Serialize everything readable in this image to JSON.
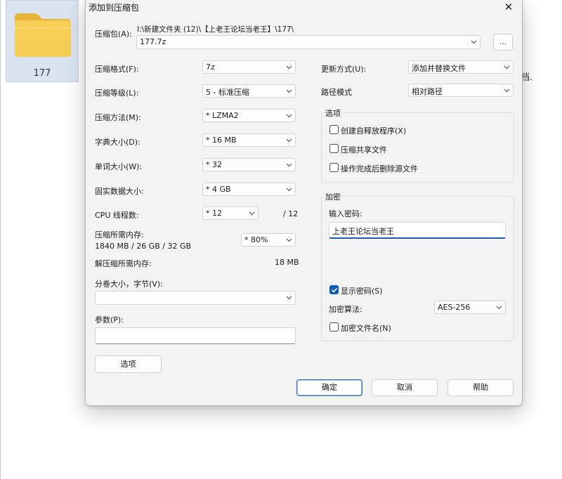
{
  "desktop": {
    "folder_name": "177",
    "right_fragment": "档."
  },
  "dialog": {
    "title": "添加到压缩包",
    "archive_label": "压缩包(A):",
    "archive_path": "I:\\新建文件夹 (12)\\【上老王论坛当老王】\\177\\",
    "archive_name": "177.7z",
    "browse_label": "...",
    "left": {
      "format_label": "压缩格式(F):",
      "format_value": "7z",
      "level_label": "压缩等级(L):",
      "level_value": "5 - 标准压缩",
      "method_label": "压缩方法(M):",
      "method_value": "* LZMA2",
      "dict_label": "字典大小(D):",
      "dict_value": "* 16 MB",
      "word_label": "单词大小(W):",
      "word_value": "* 32",
      "solid_label": "固实数据大小:",
      "solid_value": "* 4 GB",
      "threads_label": "CPU 线程数:",
      "threads_value": "* 12",
      "threads_total": "/ 12",
      "mem_label": "压缩所需内存:",
      "mem_detail": "1840 MB / 26 GB / 32 GB",
      "mem_percent": "* 80%",
      "decomp_label": "解压缩所需内存:",
      "decomp_value": "18 MB",
      "volume_label": "分卷大小，字节(V):",
      "volume_value": "",
      "params_label": "参数(P):",
      "params_value": "",
      "options_button": "选项"
    },
    "right": {
      "update_label": "更新方式(U):",
      "update_value": "添加并替换文件",
      "path_label": "路径模式",
      "path_value": "相对路径",
      "options_group": "选项",
      "opt_sfx": "创建自释放程序(X)",
      "opt_shared": "压缩共享文件",
      "opt_delete": "操作完成后删除源文件",
      "encrypt_group": "加密",
      "password_label": "输入密码:",
      "password_value": "上老王论坛当老王",
      "show_password": "显示密码(S)",
      "enc_method_label": "加密算法:",
      "enc_method_value": "AES-256",
      "encrypt_names": "加密文件名(N)"
    },
    "buttons": {
      "ok": "确定",
      "cancel": "取消",
      "help": "帮助"
    }
  }
}
